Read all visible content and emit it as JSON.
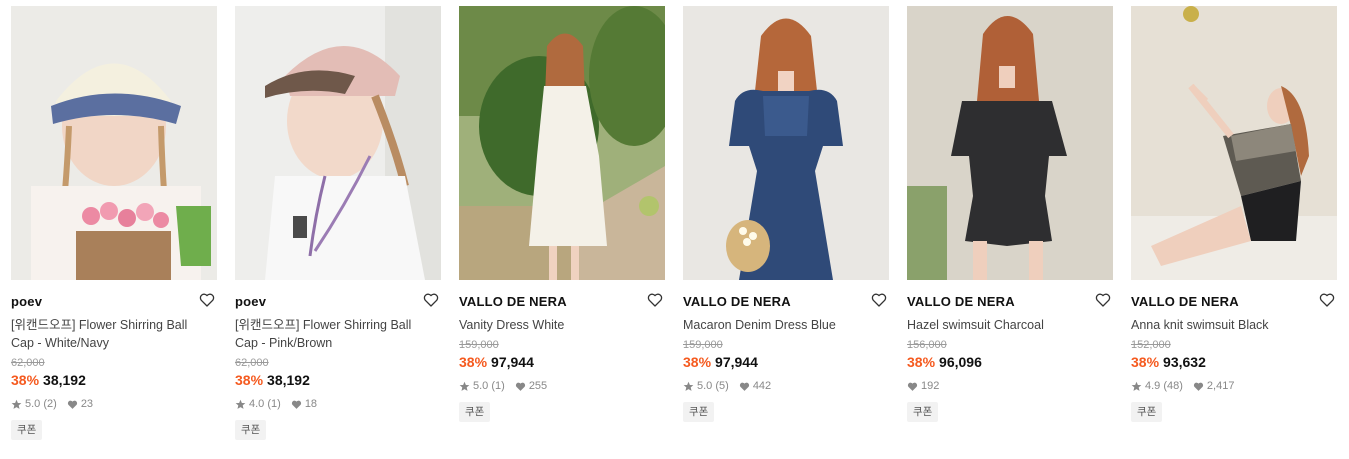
{
  "products": [
    {
      "brand": "poev",
      "name": "[위캔드오프] Flower Shirring Ball Cap - White/Navy",
      "original_price": "62,000",
      "discount": "38%",
      "price": "38,192",
      "rating": "5.0",
      "review_count": "(2)",
      "likes": "23",
      "coupon": "쿠폰"
    },
    {
      "brand": "poev",
      "name": "[위캔드오프] Flower Shirring Ball Cap - Pink/Brown",
      "original_price": "62,000",
      "discount": "38%",
      "price": "38,192",
      "rating": "4.0",
      "review_count": "(1)",
      "likes": "18",
      "coupon": "쿠폰"
    },
    {
      "brand": "VALLO DE NERA",
      "name": "Vanity Dress White",
      "original_price": "159,000",
      "discount": "38%",
      "price": "97,944",
      "rating": "5.0",
      "review_count": "(1)",
      "likes": "255",
      "coupon": "쿠폰"
    },
    {
      "brand": "VALLO DE NERA",
      "name": "Macaron Denim Dress Blue",
      "original_price": "159,000",
      "discount": "38%",
      "price": "97,944",
      "rating": "5.0",
      "review_count": "(5)",
      "likes": "442",
      "coupon": "쿠폰"
    },
    {
      "brand": "VALLO DE NERA",
      "name": "Hazel swimsuit Charcoal",
      "original_price": "156,000",
      "discount": "38%",
      "price": "96,096",
      "rating": "",
      "review_count": "",
      "likes": "192",
      "coupon": "쿠폰"
    },
    {
      "brand": "VALLO DE NERA",
      "name": "Anna knit swimsuit Black",
      "original_price": "152,000",
      "discount": "38%",
      "price": "93,632",
      "rating": "4.9",
      "review_count": "(48)",
      "likes": "2,417",
      "coupon": "쿠폰"
    }
  ],
  "colors": {
    "discount": "#f55a1f",
    "muted": "#9a9a9a",
    "icon": "#888888"
  },
  "icons": {
    "wishlist": "heart-outline-icon",
    "rating": "star-icon",
    "likes": "heart-filled-icon"
  }
}
